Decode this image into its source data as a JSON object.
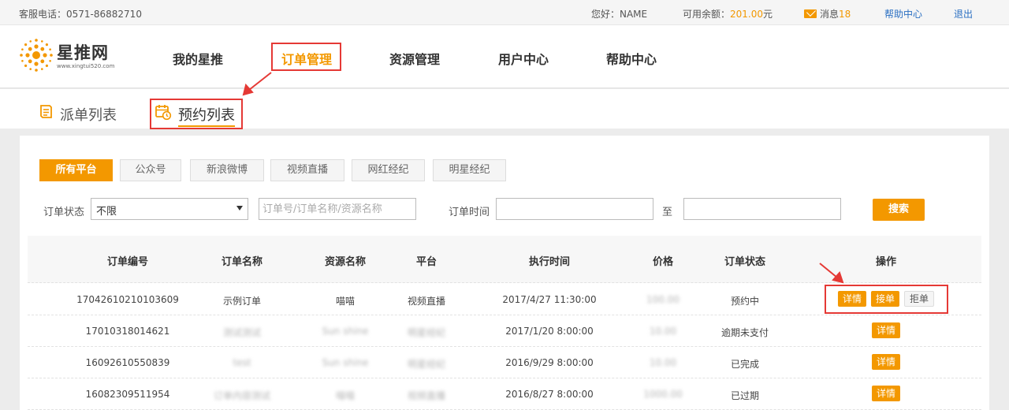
{
  "topbar": {
    "phone": "客服电话：0571-86882710",
    "greeting": "您好：NAME",
    "balance_label": "可用余额：",
    "balance_value": "201.00",
    "balance_unit": "元",
    "message_label": "消息",
    "message_count": "18",
    "help": "帮助中心",
    "logout": "退出"
  },
  "logo": {
    "name": "星推网",
    "url": "www.xingtui520.com"
  },
  "nav": {
    "items": [
      {
        "label": "我的星推"
      },
      {
        "label": "订单管理"
      },
      {
        "label": "资源管理"
      },
      {
        "label": "用户中心"
      },
      {
        "label": "帮助中心"
      }
    ]
  },
  "subnav": {
    "tabs": [
      {
        "label": "派单列表"
      },
      {
        "label": "预约列表"
      }
    ]
  },
  "platforms": [
    "所有平台",
    "公众号",
    "新浪微博",
    "视频直播",
    "网红经纪",
    "明星经纪"
  ],
  "filter": {
    "status_label": "订单状态",
    "status_value": "不限",
    "keyword_placeholder": "订单号/订单名称/资源名称",
    "time_label": "订单时间",
    "to_label": "至",
    "search_label": "搜索"
  },
  "table": {
    "headers": [
      "订单编号",
      "订单名称",
      "资源名称",
      "平台",
      "执行时间",
      "价格",
      "订单状态",
      "操作"
    ],
    "rows": [
      {
        "id": "17042610210103609",
        "name": "示例订单",
        "resource": "喵喵",
        "platform": "视频直播",
        "time": "2017/4/27 11:30:00",
        "price": "100.00",
        "status": "预约中",
        "actions": [
          "详情",
          "接单",
          "拒单"
        ]
      },
      {
        "id": "17010318014621",
        "name": "测试测试",
        "resource": "Sun shine",
        "platform": "明星经纪",
        "time": "2017/1/20 8:00:00",
        "price": "10.00",
        "status": "逾期未支付",
        "actions": [
          "详情"
        ]
      },
      {
        "id": "16092610550839",
        "name": "test",
        "resource": "Sun shine",
        "platform": "明星经纪",
        "time": "2016/9/29 8:00:00",
        "price": "10.00",
        "status": "已完成",
        "actions": [
          "详情"
        ]
      },
      {
        "id": "16082309511954",
        "name": "订单内容测试",
        "resource": "喵喵",
        "platform": "视频直播",
        "time": "2016/8/27 8:00:00",
        "price": "1000.00",
        "status": "已过期",
        "actions": [
          "详情"
        ]
      }
    ]
  },
  "colors": {
    "accent": "#f39800",
    "highlight": "#e53935",
    "link": "#2a6fc2"
  }
}
